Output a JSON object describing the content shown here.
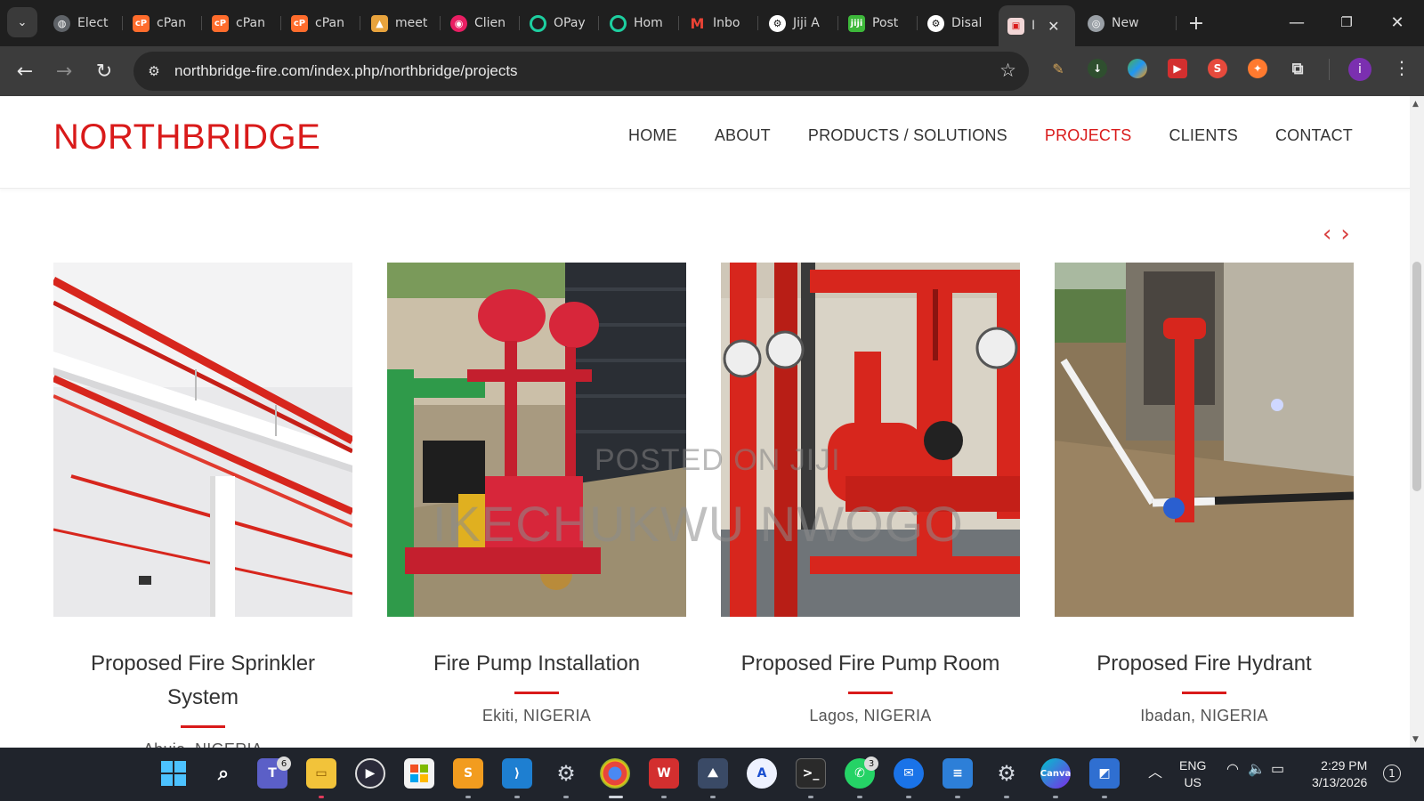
{
  "browser": {
    "tabs": [
      {
        "label": "Elect",
        "icon": "globe-icon",
        "color": "#5f6368"
      },
      {
        "label": "cPan",
        "icon": "cpanel-icon",
        "color": "#ff6c2c"
      },
      {
        "label": "cPan",
        "icon": "cpanel-icon",
        "color": "#ff6c2c"
      },
      {
        "label": "cPan",
        "icon": "cpanel-icon",
        "color": "#ff6c2c"
      },
      {
        "label": "meet",
        "icon": "meet-icon",
        "color": "#e8a33d"
      },
      {
        "label": "Clien",
        "icon": "client-icon",
        "color": "#e91e63"
      },
      {
        "label": "OPay",
        "icon": "opay-icon",
        "color": "#1dcfa0"
      },
      {
        "label": "Hom",
        "icon": "opay-icon",
        "color": "#1dcfa0"
      },
      {
        "label": "Inbo",
        "icon": "gmail-icon",
        "color": "#ea4335"
      },
      {
        "label": "Jiji A",
        "icon": "openai-icon",
        "color": "#ffffff"
      },
      {
        "label": "Post",
        "icon": "jiji-icon",
        "color": "#3db83a"
      },
      {
        "label": "Disal",
        "icon": "openai-icon",
        "color": "#ffffff"
      },
      {
        "label": "I",
        "icon": "northbridge-favicon",
        "color": "#d91a1a",
        "active": true
      },
      {
        "label": "New",
        "icon": "chrome-icon",
        "color": "#9aa0a6"
      }
    ],
    "url": "northbridge-fire.com/index.php/northbridge/projects"
  },
  "site": {
    "logo": "NORTHBRIDGE",
    "nav": [
      "HOME",
      "ABOUT",
      "PRODUCTS / SOLUTIONS",
      "PROJECTS",
      "CLIENTS",
      "CONTACT"
    ],
    "active_nav": "PROJECTS",
    "brand_color": "#d91a1a",
    "slider": {
      "prev": "‹",
      "next": "›"
    },
    "projects": [
      {
        "title": "Proposed Fire Sprinkler System",
        "location": "Abuja, NIGERIA"
      },
      {
        "title": "Fire Pump Installation",
        "location": "Ekiti, NIGERIA"
      },
      {
        "title": "Proposed Fire Pump Room",
        "location": "Lagos, NIGERIA"
      },
      {
        "title": "Proposed Fire Hydrant",
        "location": "Ibadan, NIGERIA"
      }
    ],
    "watermark": {
      "line1": "POSTED ON JIJI",
      "line2": "IKECHUKWU NWOGO"
    }
  },
  "taskbar": {
    "badges": {
      "teams": "6",
      "whatsapp": "3"
    },
    "language": {
      "lang": "ENG",
      "region": "US"
    },
    "time": "2:29 PM",
    "date": "3/13/2026",
    "notifications": "1"
  }
}
